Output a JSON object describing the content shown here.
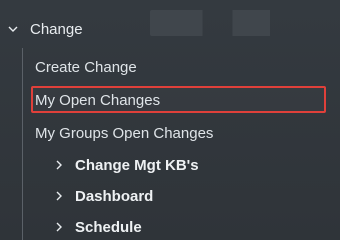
{
  "menu": {
    "parent": {
      "label": "Change",
      "expanded": true,
      "icon": "chevron-down-icon"
    },
    "items": [
      {
        "label": "Create Change",
        "type": "link"
      },
      {
        "label": "My Open Changes",
        "type": "link",
        "highlighted": true
      },
      {
        "label": "My Groups Open Changes",
        "type": "link"
      },
      {
        "label": "Change Mgt KB's",
        "type": "folder",
        "icon": "chevron-right-icon"
      },
      {
        "label": "Dashboard",
        "type": "folder",
        "icon": "chevron-right-icon"
      },
      {
        "label": "Schedule",
        "type": "folder",
        "icon": "chevron-right-icon"
      }
    ]
  },
  "colors": {
    "background": "#333940",
    "text": "#e8ecef",
    "highlight_border": "#e0403a"
  }
}
